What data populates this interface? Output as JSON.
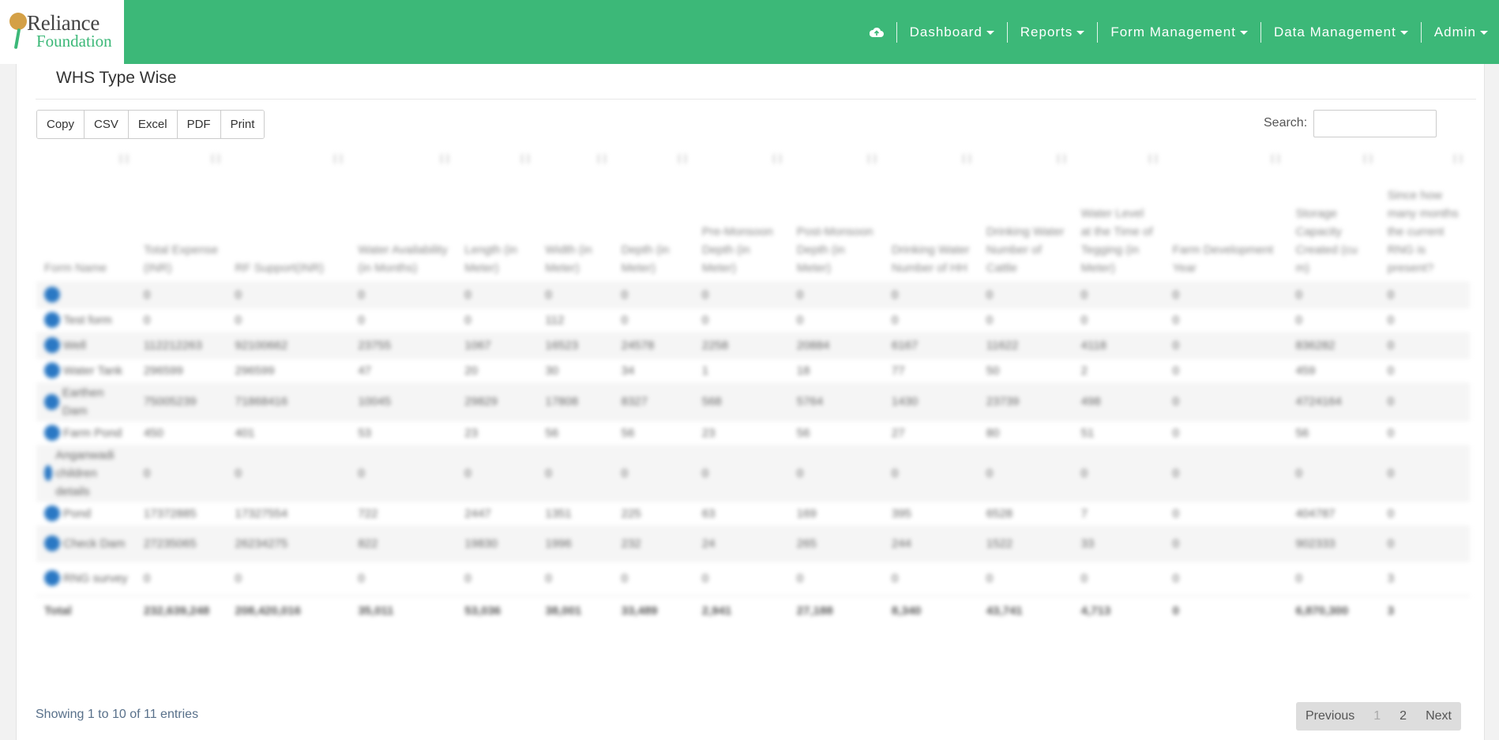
{
  "brand": {
    "line1": "Reliance",
    "line2": "Foundation"
  },
  "nav": {
    "icon": "cloud-upload-icon",
    "items": [
      {
        "label": "Dashboard"
      },
      {
        "label": "Reports"
      },
      {
        "label": "Form Management"
      },
      {
        "label": "Data Management"
      },
      {
        "label": "Admin"
      }
    ]
  },
  "card": {
    "title": "WHS Type Wise"
  },
  "toolbar": {
    "copy": "Copy",
    "csv": "CSV",
    "excel": "Excel",
    "pdf": "PDF",
    "print": "Print"
  },
  "search": {
    "label": "Search:",
    "placeholder": ""
  },
  "table": {
    "headers": [
      "Form Name",
      "Total Expense (INR)",
      "RF Support(INR)",
      "Water Availability (in Months)",
      "Length (in Meter)",
      "Width (in Meter)",
      "Depth (in Meter)",
      "Pre-Monsoon Depth (in Meter)",
      "Post-Monsoon Depth (in Meter)",
      "Drinking Water Number of HH",
      "Drinking Water Number of Cattle",
      "Water Level at the Time of Tegging (in Meter)",
      "Farm Development Year",
      "Storage Capacity Created (cu m)",
      "Since how many months the current RNG is present?"
    ],
    "rows": [
      [
        "",
        "0",
        "0",
        "0",
        "0",
        "0",
        "0",
        "0",
        "0",
        "0",
        "0",
        "0",
        "0",
        "0",
        "0"
      ],
      [
        "Test form",
        "0",
        "0",
        "0",
        "0",
        "112",
        "0",
        "0",
        "0",
        "0",
        "0",
        "0",
        "0",
        "0",
        "0"
      ],
      [
        "Well",
        "112212263",
        "92100662",
        "23755",
        "1067",
        "16523",
        "24578",
        "2258",
        "20884",
        "6167",
        "11622",
        "4118",
        "0",
        "836282",
        "0"
      ],
      [
        "Water Tank",
        "296599",
        "296599",
        "47",
        "20",
        "30",
        "34",
        "1",
        "18",
        "77",
        "50",
        "2",
        "0",
        "459",
        "0"
      ],
      [
        "Earthen Dam",
        "75005239",
        "71868416",
        "10045",
        "29829",
        "17808",
        "8327",
        "568",
        "5764",
        "1430",
        "23739",
        "498",
        "0",
        "4724164",
        "0"
      ],
      [
        "Farm Pond",
        "450",
        "401",
        "53",
        "23",
        "56",
        "56",
        "23",
        "56",
        "27",
        "80",
        "51",
        "0",
        "56",
        "0"
      ],
      [
        "Anganwadi children details",
        "0",
        "0",
        "0",
        "0",
        "0",
        "0",
        "0",
        "0",
        "0",
        "0",
        "0",
        "0",
        "0",
        "0"
      ],
      [
        "Pond",
        "17372885",
        "17327554",
        "722",
        "2447",
        "1351",
        "225",
        "63",
        "169",
        "395",
        "6528",
        "7",
        "0",
        "404787",
        "0"
      ],
      [
        "Check Dam",
        "27235065",
        "26234275",
        "822",
        "19830",
        "1996",
        "232",
        "24",
        "265",
        "244",
        "1522",
        "33",
        "0",
        "902333",
        "0"
      ],
      [
        "RNG survey",
        "0",
        "0",
        "0",
        "0",
        "0",
        "0",
        "0",
        "0",
        "0",
        "0",
        "0",
        "0",
        "0",
        "3"
      ]
    ],
    "footer": [
      "Total",
      "232,639,248",
      "208,420,016",
      "35,011",
      "53,036",
      "38,001",
      "33,489",
      "2,941",
      "27,188",
      "8,340",
      "43,741",
      "4,713",
      "0",
      "6,870,300",
      "3"
    ]
  },
  "info": "Showing 1 to 10 of 11 entries",
  "pagination": {
    "previous": "Previous",
    "pages": [
      "1",
      "2"
    ],
    "next": "Next"
  }
}
